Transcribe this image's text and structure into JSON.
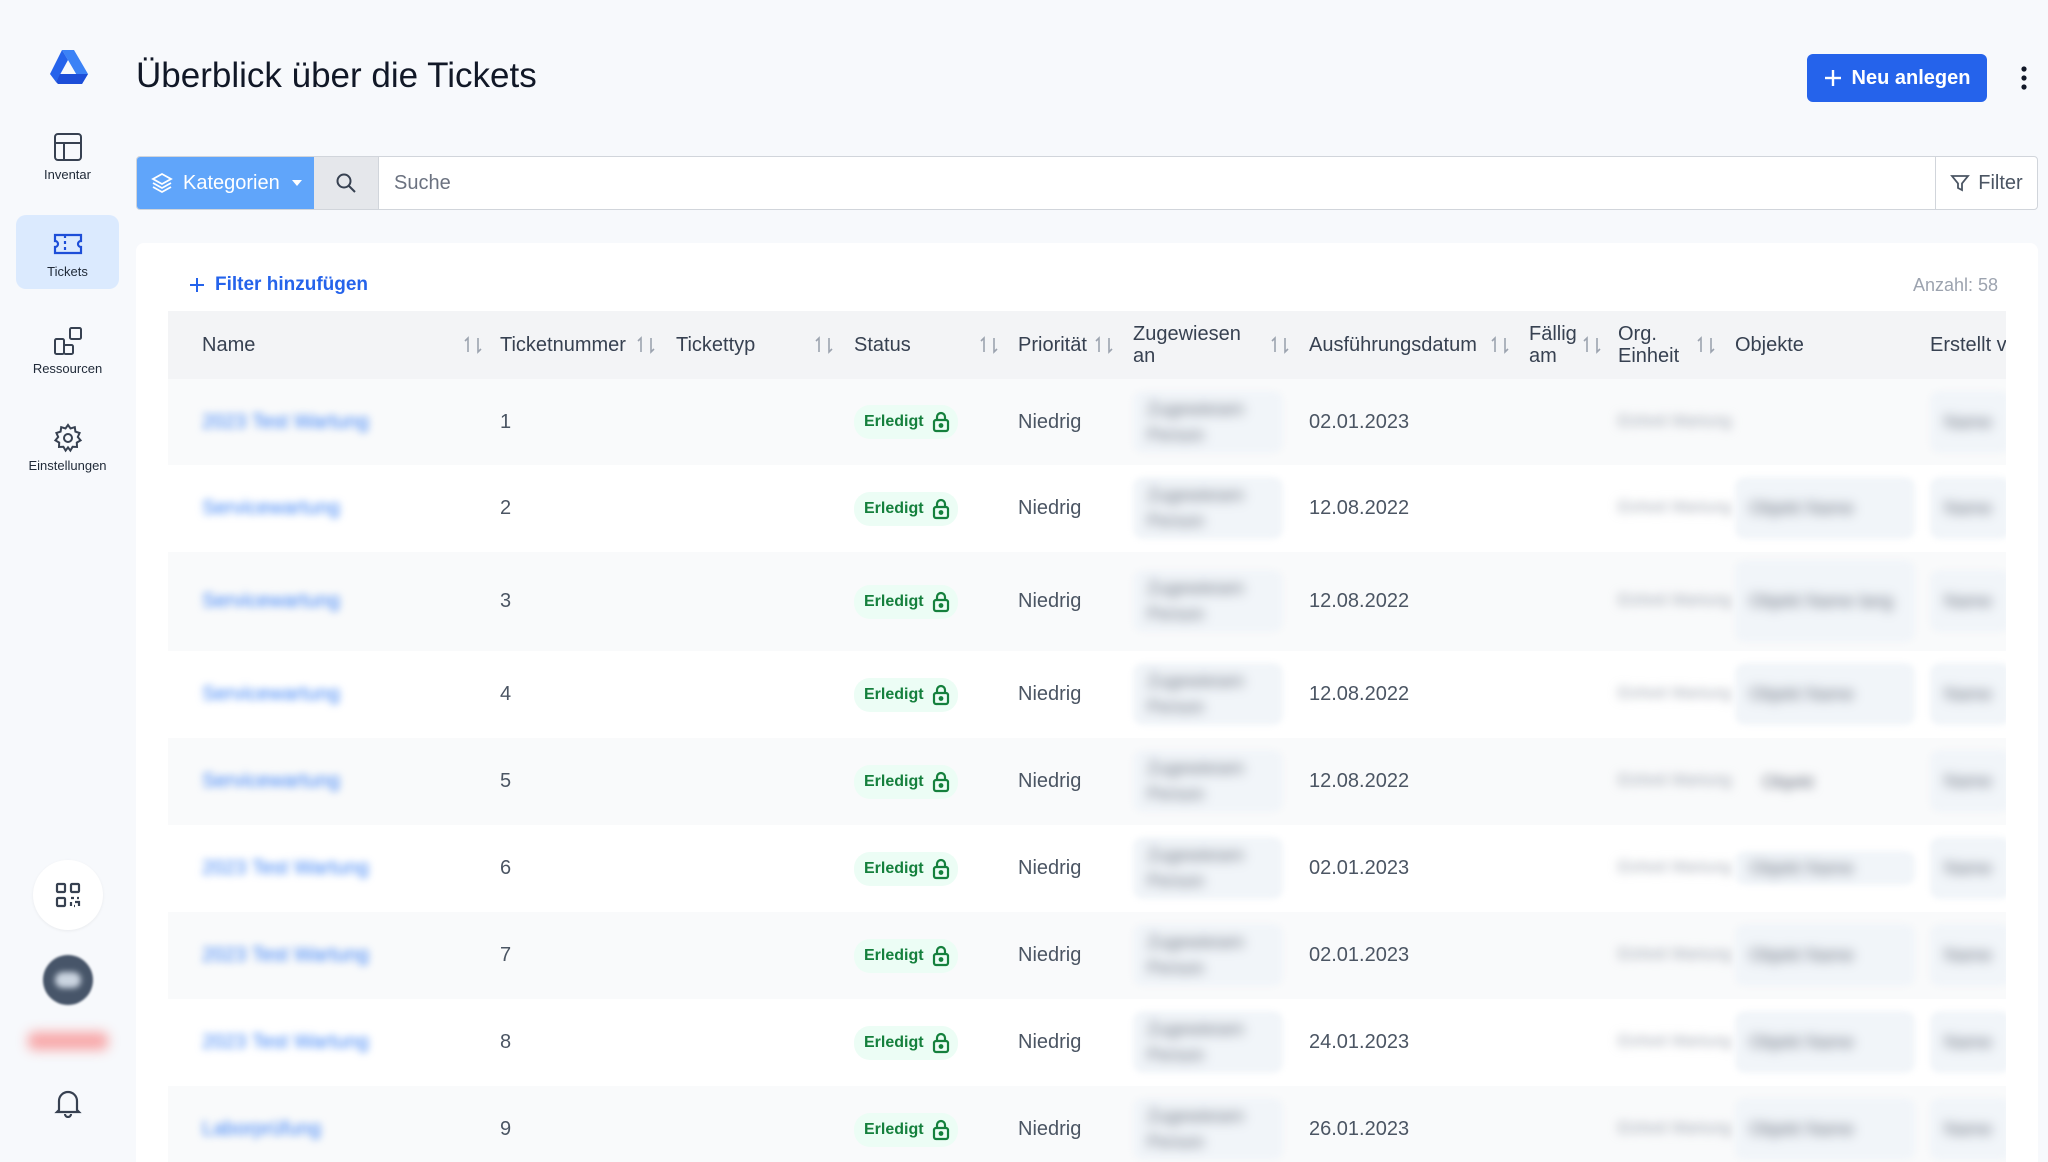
{
  "sidebar": {
    "items": [
      {
        "label": "Inventar",
        "icon": "grid-icon",
        "active": false
      },
      {
        "label": "Tickets",
        "icon": "ticket-icon",
        "active": true
      },
      {
        "label": "Ressourcen",
        "icon": "resources-icon",
        "active": false
      },
      {
        "label": "Einstellungen",
        "icon": "gear-icon",
        "active": false
      }
    ]
  },
  "header": {
    "title": "Überblick über die Tickets",
    "new_label": "Neu anlegen"
  },
  "toolbar": {
    "categories_label": "Kategorien",
    "search_placeholder": "Suche",
    "filter_label": "Filter"
  },
  "table_meta": {
    "add_filter_label": "Filter hinzufügen",
    "count_label": "Anzahl: 58"
  },
  "columns": {
    "name": "Name",
    "ticketnummer": "Ticketnummer",
    "tickettyp": "Tickettyp",
    "status": "Status",
    "prioritaet": "Priorität",
    "zugewiesen_1": "Zugewiesen",
    "zugewiesen_2": "an",
    "ausfuehrungsdatum": "Ausführungsdatum",
    "faellig_1": "Fällig",
    "faellig_2": "am",
    "org_1": "Org.",
    "org_2": "Einheit",
    "objekte": "Objekte",
    "erstellt": "Erstellt v"
  },
  "rows": [
    {
      "number": "1",
      "status": "Erledigt",
      "priority": "Niedrig",
      "date": "02.01.2023"
    },
    {
      "number": "2",
      "status": "Erledigt",
      "priority": "Niedrig",
      "date": "12.08.2022"
    },
    {
      "number": "3",
      "status": "Erledigt",
      "priority": "Niedrig",
      "date": "12.08.2022"
    },
    {
      "number": "4",
      "status": "Erledigt",
      "priority": "Niedrig",
      "date": "12.08.2022"
    },
    {
      "number": "5",
      "status": "Erledigt",
      "priority": "Niedrig",
      "date": "12.08.2022"
    },
    {
      "number": "6",
      "status": "Erledigt",
      "priority": "Niedrig",
      "date": "02.01.2023"
    },
    {
      "number": "7",
      "status": "Erledigt",
      "priority": "Niedrig",
      "date": "02.01.2023"
    },
    {
      "number": "8",
      "status": "Erledigt",
      "priority": "Niedrig",
      "date": "24.01.2023"
    },
    {
      "number": "9",
      "status": "Erledigt",
      "priority": "Niedrig",
      "date": "26.01.2023"
    }
  ],
  "colors": {
    "accent": "#2563eb",
    "category_button": "#60a5fa",
    "active_nav": "#dbeafe",
    "status_badge_bg": "#ecfdf5",
    "status_badge_text": "#15803d"
  }
}
